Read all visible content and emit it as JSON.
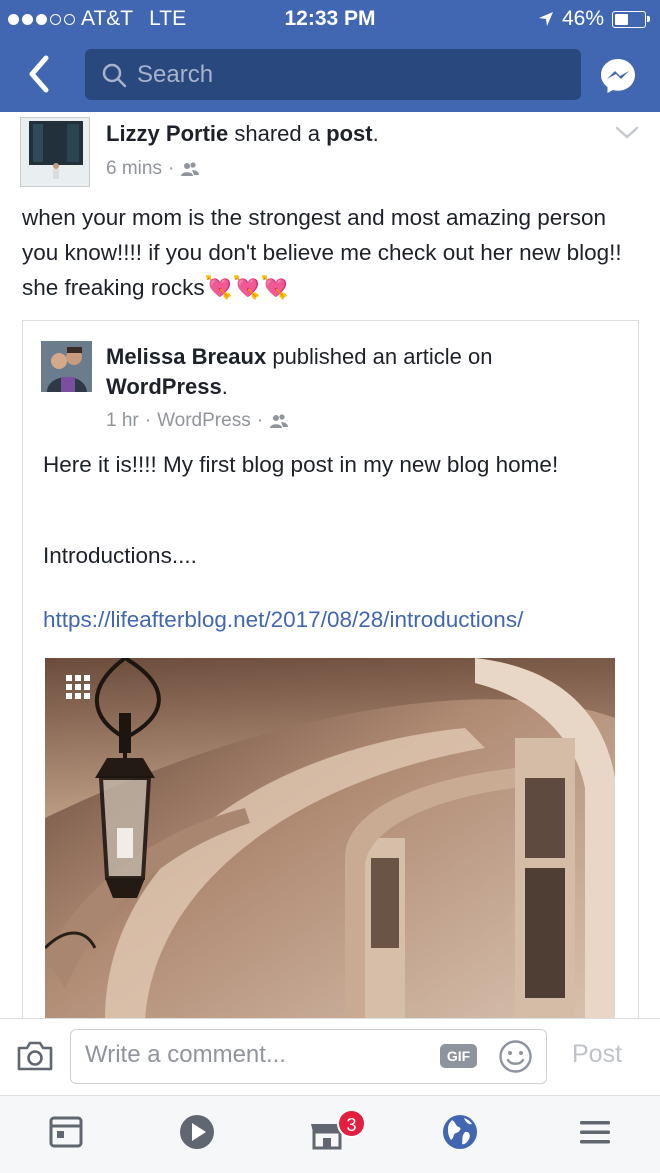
{
  "status_bar": {
    "carrier": "AT&T",
    "network": "LTE",
    "time": "12:33 PM",
    "battery": "46%",
    "battery_level": 0.46
  },
  "header": {
    "search_placeholder": "Search"
  },
  "post": {
    "author": "Lizzy Portie",
    "action_prefix": "shared a",
    "action_object": "post",
    "action_suffix": ".",
    "time": "6 mins",
    "text": "when your mom is the strongest and most amazing person you know!!!! if you don't believe me check out her new blog!! she freaking rocks💘💘💘"
  },
  "shared": {
    "author": "Melissa Breaux",
    "action": "published an article on",
    "platform": "WordPress",
    "platform_suffix": ".",
    "time": "1 hr",
    "source": "WordPress",
    "text": "Here it is!!!!  My first blog post in my new blog home!",
    "intro": "Introductions....",
    "link": "https://lifeafterblog.net/2017/08/28/introductions/"
  },
  "composer": {
    "placeholder": "Write a comment...",
    "gif_label": "GIF",
    "post_label": "Post"
  },
  "tabbar": {
    "marketplace_badge": "3"
  },
  "colors": {
    "brand": "#4267b2",
    "link": "#4267b2",
    "badge": "#e41e3f"
  }
}
